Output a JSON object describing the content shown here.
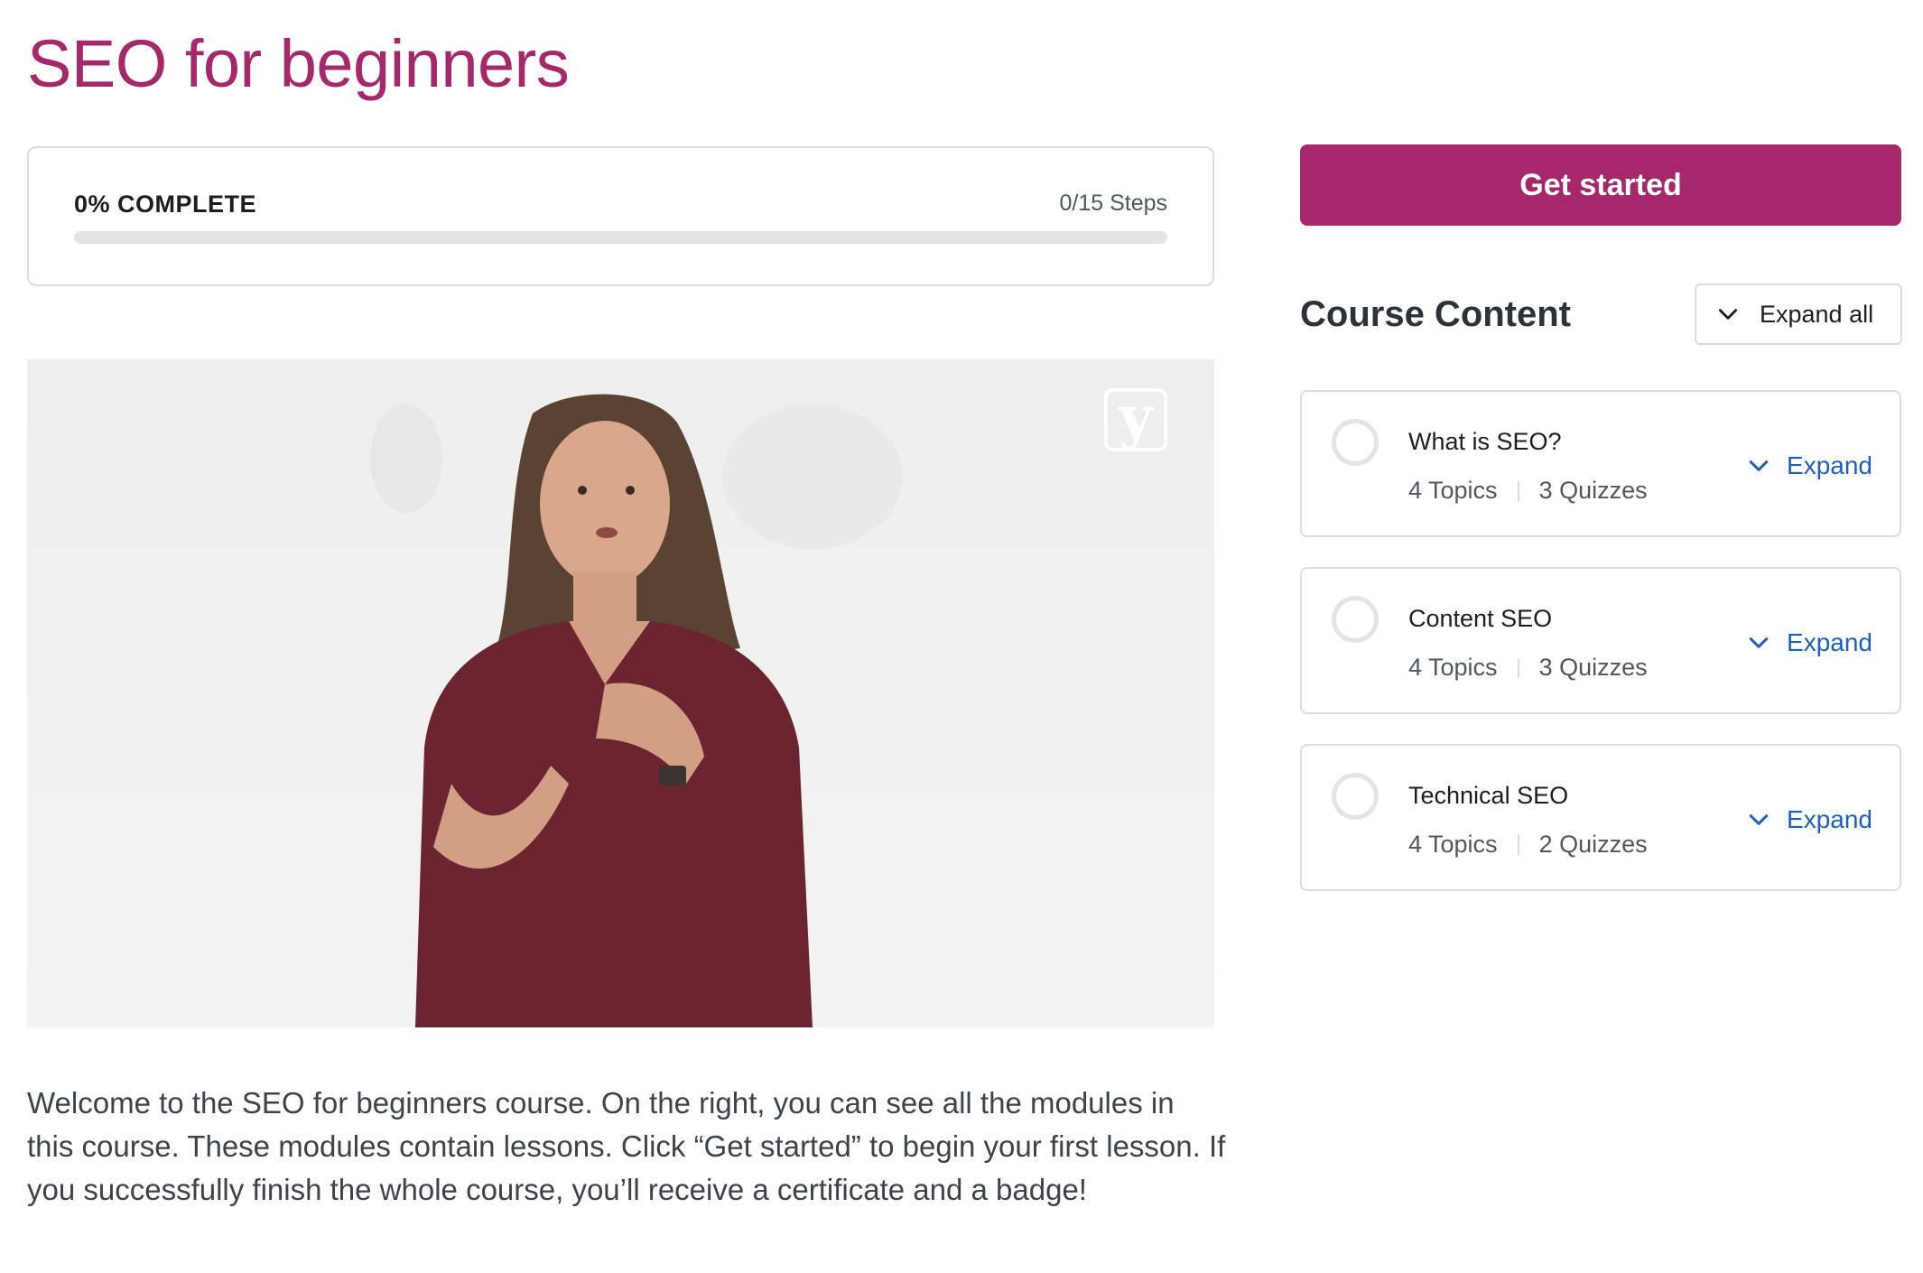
{
  "page": {
    "title": "SEO for beginners"
  },
  "progress": {
    "label": "0% COMPLETE",
    "steps": "0/15 Steps",
    "percent": 0
  },
  "video": {
    "logo": "y"
  },
  "description": "Welcome to the SEO for beginners course. On the right, you can see all the modules in this course. These modules contain lessons. Click “Get started” to begin your first lesson. If you successfully finish the whole course, you’ll receive a certificate and a badge!",
  "sidebar": {
    "cta_label": "Get started",
    "section_title": "Course Content",
    "expand_all_label": "Expand all",
    "modules": [
      {
        "title": "What is SEO?",
        "topics": "4 Topics",
        "quizzes": "3 Quizzes",
        "expand_label": "Expand"
      },
      {
        "title": "Content SEO",
        "topics": "4 Topics",
        "quizzes": "3 Quizzes",
        "expand_label": "Expand"
      },
      {
        "title": "Technical SEO",
        "topics": "4 Topics",
        "quizzes": "2 Quizzes",
        "expand_label": "Expand"
      }
    ]
  },
  "colors": {
    "brand": "#a4286a",
    "link": "#1d5fc1",
    "border": "#dcdcde",
    "text_muted": "#50575e"
  },
  "icons": {
    "expand_all": "chevron-down-icon",
    "module_expand": "chevron-down-icon",
    "module_status": "incomplete-circle-icon"
  }
}
